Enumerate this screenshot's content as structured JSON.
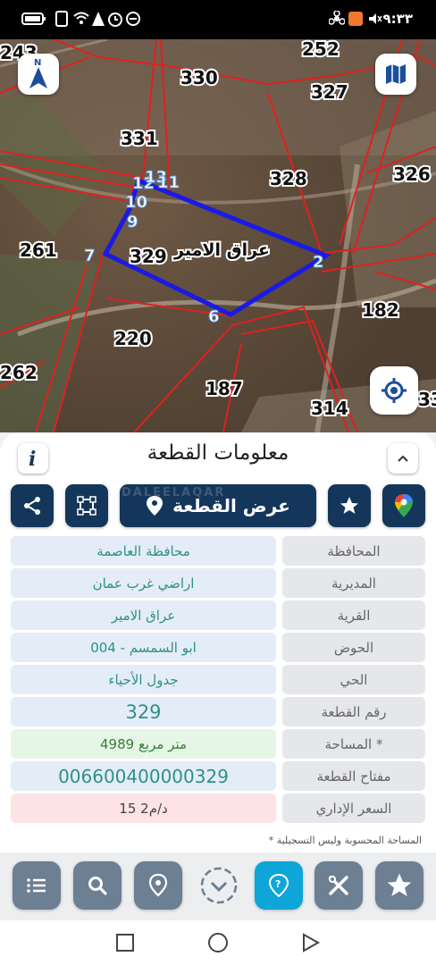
{
  "status_bar": {
    "time": "٩:٣٣",
    "icons": [
      "battery-icon",
      "sim-icon",
      "wifi-icon",
      "alarm-icon",
      "settings-icon",
      "app-icon",
      "app-icon",
      "mute-icon",
      "fan-icon"
    ]
  },
  "map": {
    "parcel_labels": [
      "243",
      "252",
      "330",
      "327",
      "331",
      "328",
      "326",
      "261",
      "182",
      "220",
      "262",
      "187",
      "314",
      "33"
    ],
    "selected_parcel": "329",
    "village_label": "عراق الامير",
    "vertex_labels": [
      "12",
      "13",
      "11",
      "10",
      "9",
      "7",
      "2",
      "6"
    ],
    "colors": {
      "boundary": "#e02020",
      "selected": "#1a1ae6"
    },
    "north_label": "N"
  },
  "panel": {
    "title": "معلومات القطعة",
    "show_parcel_label": "عرض القطعة",
    "watermark": "DALEELAQAR",
    "rows": [
      {
        "label": "المحافظة",
        "value": "محافظة العاصمة"
      },
      {
        "label": "المديرية",
        "value": "اراضي غرب عمان"
      },
      {
        "label": "القرية",
        "value": "عراق الامير"
      },
      {
        "label": "الحوض",
        "value": "ابو السمسم - 004"
      },
      {
        "label": "الحي",
        "value": "جدول الأحياء"
      },
      {
        "label": "رقم القطعة",
        "value": "329"
      },
      {
        "label": "المساحة *",
        "value": "4989  متر مربع"
      },
      {
        "label": "مفتاح القطعة",
        "value": "006600400000329"
      },
      {
        "label": "السعر الإداري",
        "value": "15 د/م2"
      }
    ],
    "footnote": "* المساحة المحسوبة وليس التسجيلية"
  },
  "colors": {
    "navy": "#14365b",
    "teal": "#2f8f8a",
    "accent": "#0ea5d9",
    "area_bg": "#e6f6e6",
    "price_bg": "#fde3e6",
    "slate": "#6c7f93"
  }
}
